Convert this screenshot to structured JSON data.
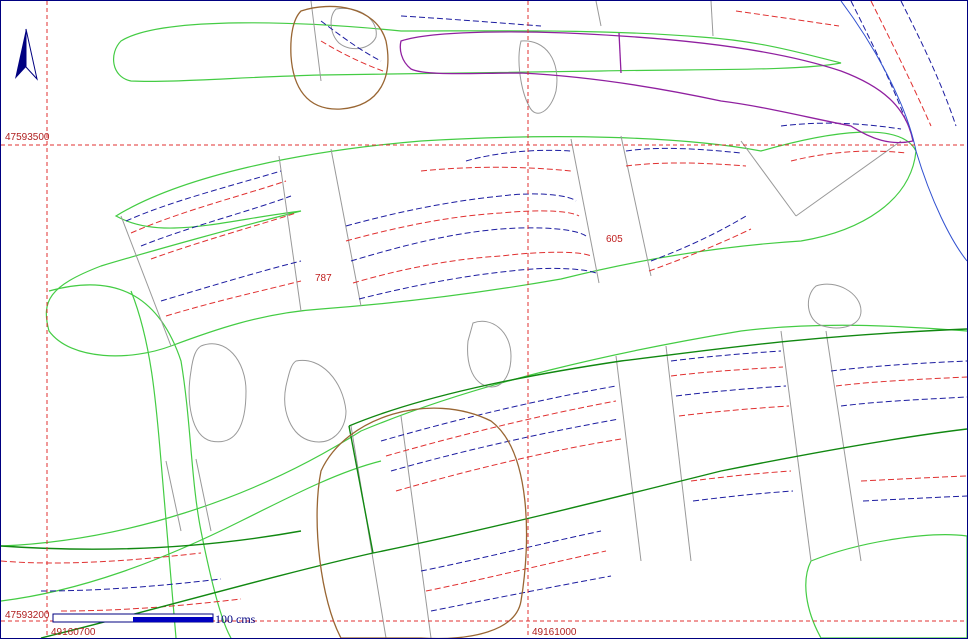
{
  "map": {
    "north_arrow_icon": "north-arrow-icon",
    "grid": {
      "northings": [
        "47593500",
        "47593200"
      ],
      "eastings": [
        "49160700",
        "49161000"
      ]
    },
    "parcels": [
      "787",
      "605"
    ],
    "scale_bar": {
      "label": "100  cms"
    },
    "colors": {
      "grid": "#e03030",
      "contour_blue": "#1c1ca0",
      "contour_red": "#e03030",
      "vegetation": "#44cc44",
      "road": "#118811",
      "boundary": "#996633",
      "outcrop": "#999999",
      "enclosure": "#9020a0",
      "stream": "#3050d0"
    }
  }
}
